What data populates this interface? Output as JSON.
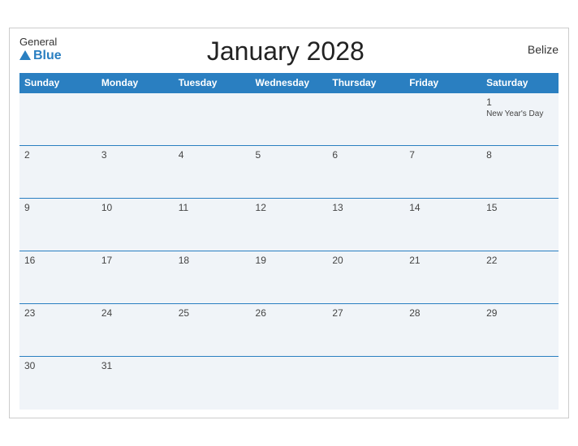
{
  "header": {
    "logo_general": "General",
    "logo_blue": "Blue",
    "title": "January 2028",
    "country": "Belize"
  },
  "weekdays": [
    "Sunday",
    "Monday",
    "Tuesday",
    "Wednesday",
    "Thursday",
    "Friday",
    "Saturday"
  ],
  "weeks": [
    [
      {
        "day": "",
        "event": ""
      },
      {
        "day": "",
        "event": ""
      },
      {
        "day": "",
        "event": ""
      },
      {
        "day": "",
        "event": ""
      },
      {
        "day": "",
        "event": ""
      },
      {
        "day": "",
        "event": ""
      },
      {
        "day": "1",
        "event": "New Year's Day"
      }
    ],
    [
      {
        "day": "2",
        "event": ""
      },
      {
        "day": "3",
        "event": ""
      },
      {
        "day": "4",
        "event": ""
      },
      {
        "day": "5",
        "event": ""
      },
      {
        "day": "6",
        "event": ""
      },
      {
        "day": "7",
        "event": ""
      },
      {
        "day": "8",
        "event": ""
      }
    ],
    [
      {
        "day": "9",
        "event": ""
      },
      {
        "day": "10",
        "event": ""
      },
      {
        "day": "11",
        "event": ""
      },
      {
        "day": "12",
        "event": ""
      },
      {
        "day": "13",
        "event": ""
      },
      {
        "day": "14",
        "event": ""
      },
      {
        "day": "15",
        "event": ""
      }
    ],
    [
      {
        "day": "16",
        "event": ""
      },
      {
        "day": "17",
        "event": ""
      },
      {
        "day": "18",
        "event": ""
      },
      {
        "day": "19",
        "event": ""
      },
      {
        "day": "20",
        "event": ""
      },
      {
        "day": "21",
        "event": ""
      },
      {
        "day": "22",
        "event": ""
      }
    ],
    [
      {
        "day": "23",
        "event": ""
      },
      {
        "day": "24",
        "event": ""
      },
      {
        "day": "25",
        "event": ""
      },
      {
        "day": "26",
        "event": ""
      },
      {
        "day": "27",
        "event": ""
      },
      {
        "day": "28",
        "event": ""
      },
      {
        "day": "29",
        "event": ""
      }
    ],
    [
      {
        "day": "30",
        "event": ""
      },
      {
        "day": "31",
        "event": ""
      },
      {
        "day": "",
        "event": ""
      },
      {
        "day": "",
        "event": ""
      },
      {
        "day": "",
        "event": ""
      },
      {
        "day": "",
        "event": ""
      },
      {
        "day": "",
        "event": ""
      }
    ]
  ],
  "colors": {
    "header_bg": "#2a7fc1",
    "cell_bg": "#f0f4f8",
    "border": "#2a7fc1"
  }
}
